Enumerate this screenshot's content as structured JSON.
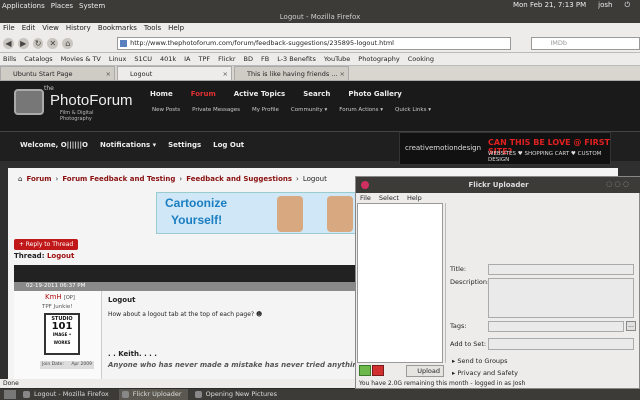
{
  "gnome_panel": {
    "menus": [
      "Applications",
      "Places",
      "System"
    ],
    "datetime": "Mon Feb 21, 7:13 PM",
    "user": "josh"
  },
  "firefox": {
    "window_title": "Logout - Mozilla Firefox",
    "menu": [
      "File",
      "Edit",
      "View",
      "History",
      "Bookmarks",
      "Tools",
      "Help"
    ],
    "url": "http://www.thephotoforum.com/forum/feedback-suggestions/235895-logout.html",
    "search_placeholder": "IMDb",
    "bookmarks": [
      "Bills",
      "Catalogs",
      "Movies & TV",
      "Linux",
      "S1CU",
      "401k",
      "IA",
      "TPF",
      "Flickr",
      "BD",
      "FB",
      "L-3 Benefits",
      "YouTube",
      "Photography",
      "Cooking"
    ],
    "tabs": [
      "Ubuntu Start Page",
      "Logout",
      "This is like having friends ..."
    ],
    "status": "Done"
  },
  "forum": {
    "logo_the": "the",
    "logo_name": "PhotoForum",
    "logo_tag": "Film & Digital Photography",
    "nav": [
      "Home",
      "Forum",
      "Active Topics",
      "Search",
      "Photo Gallery"
    ],
    "subnav": [
      "New Posts",
      "Private Messages",
      "My Profile",
      "Community ▾",
      "Forum Actions ▾",
      "Quick Links ▾"
    ],
    "welcome": "Welcome, O||||||O",
    "user_links": [
      "Notifications ▾",
      "Settings",
      "Log Out"
    ],
    "ad": {
      "brand": "creativemotiondesign",
      "headline": "CAN THIS BE LOVE @ FIRST SITE?",
      "sub": "WEBSITES ♥ SHOPPING CART ♥ CUSTOM DESIGN"
    },
    "breadcrumb": [
      "Forum",
      "Forum Feedback and Testing",
      "Feedback and Suggestions",
      "Logout"
    ],
    "banner": {
      "line1": "Cartoonize",
      "line2": "Yourself!"
    },
    "reply_button": "+ Reply to Thread",
    "thread_label": "Thread:",
    "thread_name": "Logout",
    "post": {
      "date": "02-19-2011 06:37 PM",
      "username": "KmH",
      "op": "[OP]",
      "user_title": "TPF Junkie!",
      "avatar_lines": [
        "STUDIO",
        "101",
        "IMAGE • WORKS"
      ],
      "join_label": "Join Date:",
      "join_value": "Apr 2009",
      "title": "Logout",
      "body": "How about a logout tab at the top of each page?",
      "sig1": ". . Keith. . . .",
      "sig2": "Anyone who has never made a mistake has never tried anything"
    }
  },
  "flickr_uploader": {
    "title": "Flickr Uploader",
    "menu": [
      "File",
      "Select",
      "Help"
    ],
    "fields": {
      "title": "Title:",
      "description": "Description:",
      "tags": "Tags:",
      "add_to_set": "Add to Set:"
    },
    "tags_button": "...",
    "upload": "Upload",
    "send_to_groups": "Send to Groups",
    "privacy": "Privacy and Safety",
    "status": "You have 2.0G remaining this month - logged in as Josh"
  },
  "taskbar": [
    "Logout - Mozilla Firefox",
    "Flickr Uploader",
    "Opening New Pictures"
  ]
}
